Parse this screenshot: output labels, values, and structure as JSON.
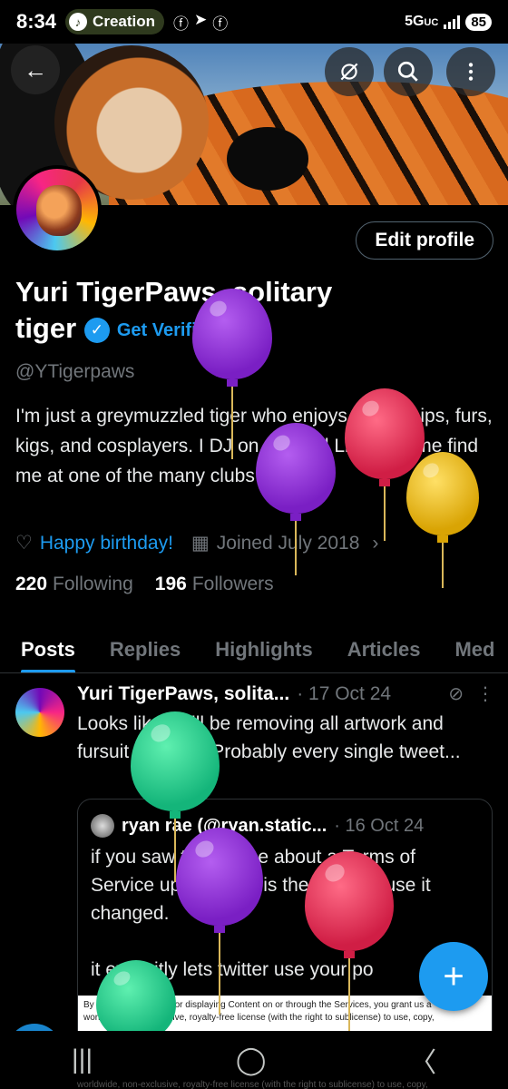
{
  "status_bar": {
    "time": "8:34",
    "creation_label": "Creation",
    "network": "5G",
    "network_sub": "UC",
    "battery": "85"
  },
  "profile": {
    "display_name": "Yuri TigerPaws, solitary tiger",
    "get_verified_label": "Get Verified",
    "handle": "@YTigerpaws",
    "bio": "I'm just a greymuzzled tiger who enjoys friendships, furs, kigs, and cosplayers. I DJ on Second Life so come find me at one of the many clubs I'm at!",
    "birthday_label": "Happy birthday!",
    "joined_label": "Joined July 2018",
    "following_count": "220",
    "following_label": "Following",
    "followers_count": "196",
    "followers_label": "Followers",
    "edit_profile_label": "Edit profile"
  },
  "tabs": [
    {
      "label": "Posts",
      "active": true
    },
    {
      "label": "Replies"
    },
    {
      "label": "Highlights"
    },
    {
      "label": "Articles"
    },
    {
      "label": "Med"
    }
  ],
  "post": {
    "author": "Yuri TigerPaws, solita...",
    "date": "· 17 Oct 24",
    "text": "Looks like I will be removing all artwork and fursuit pictures. Probably every single tweet...",
    "quote": {
      "author": "ryan rae (@ryan.static...",
      "date": "· 16 Oct 24",
      "text_1": "if you saw that notice about a Terms of Service update, this is the main clause it changed.",
      "text_2": "it explicitly lets twitter use your po",
      "image_text_1": "By submitting, posting or displaying Content on or through the Services, you grant us a",
      "image_text_2": "worldwide, non-exclusive, royalty-free license (with the right to sublicense) to use, copy,"
    }
  },
  "bottom_text": "worldwide, non-exclusive, royalty-free license (with the right to sublicense) to use, copy,",
  "icons": {
    "back": "←",
    "mute": "mute-icon",
    "search": "search-icon",
    "more": "more-vertical-icon",
    "compose": "+"
  },
  "colors": {
    "accent": "#1d9bf0",
    "background": "#000000",
    "muted_text": "#71767b"
  }
}
